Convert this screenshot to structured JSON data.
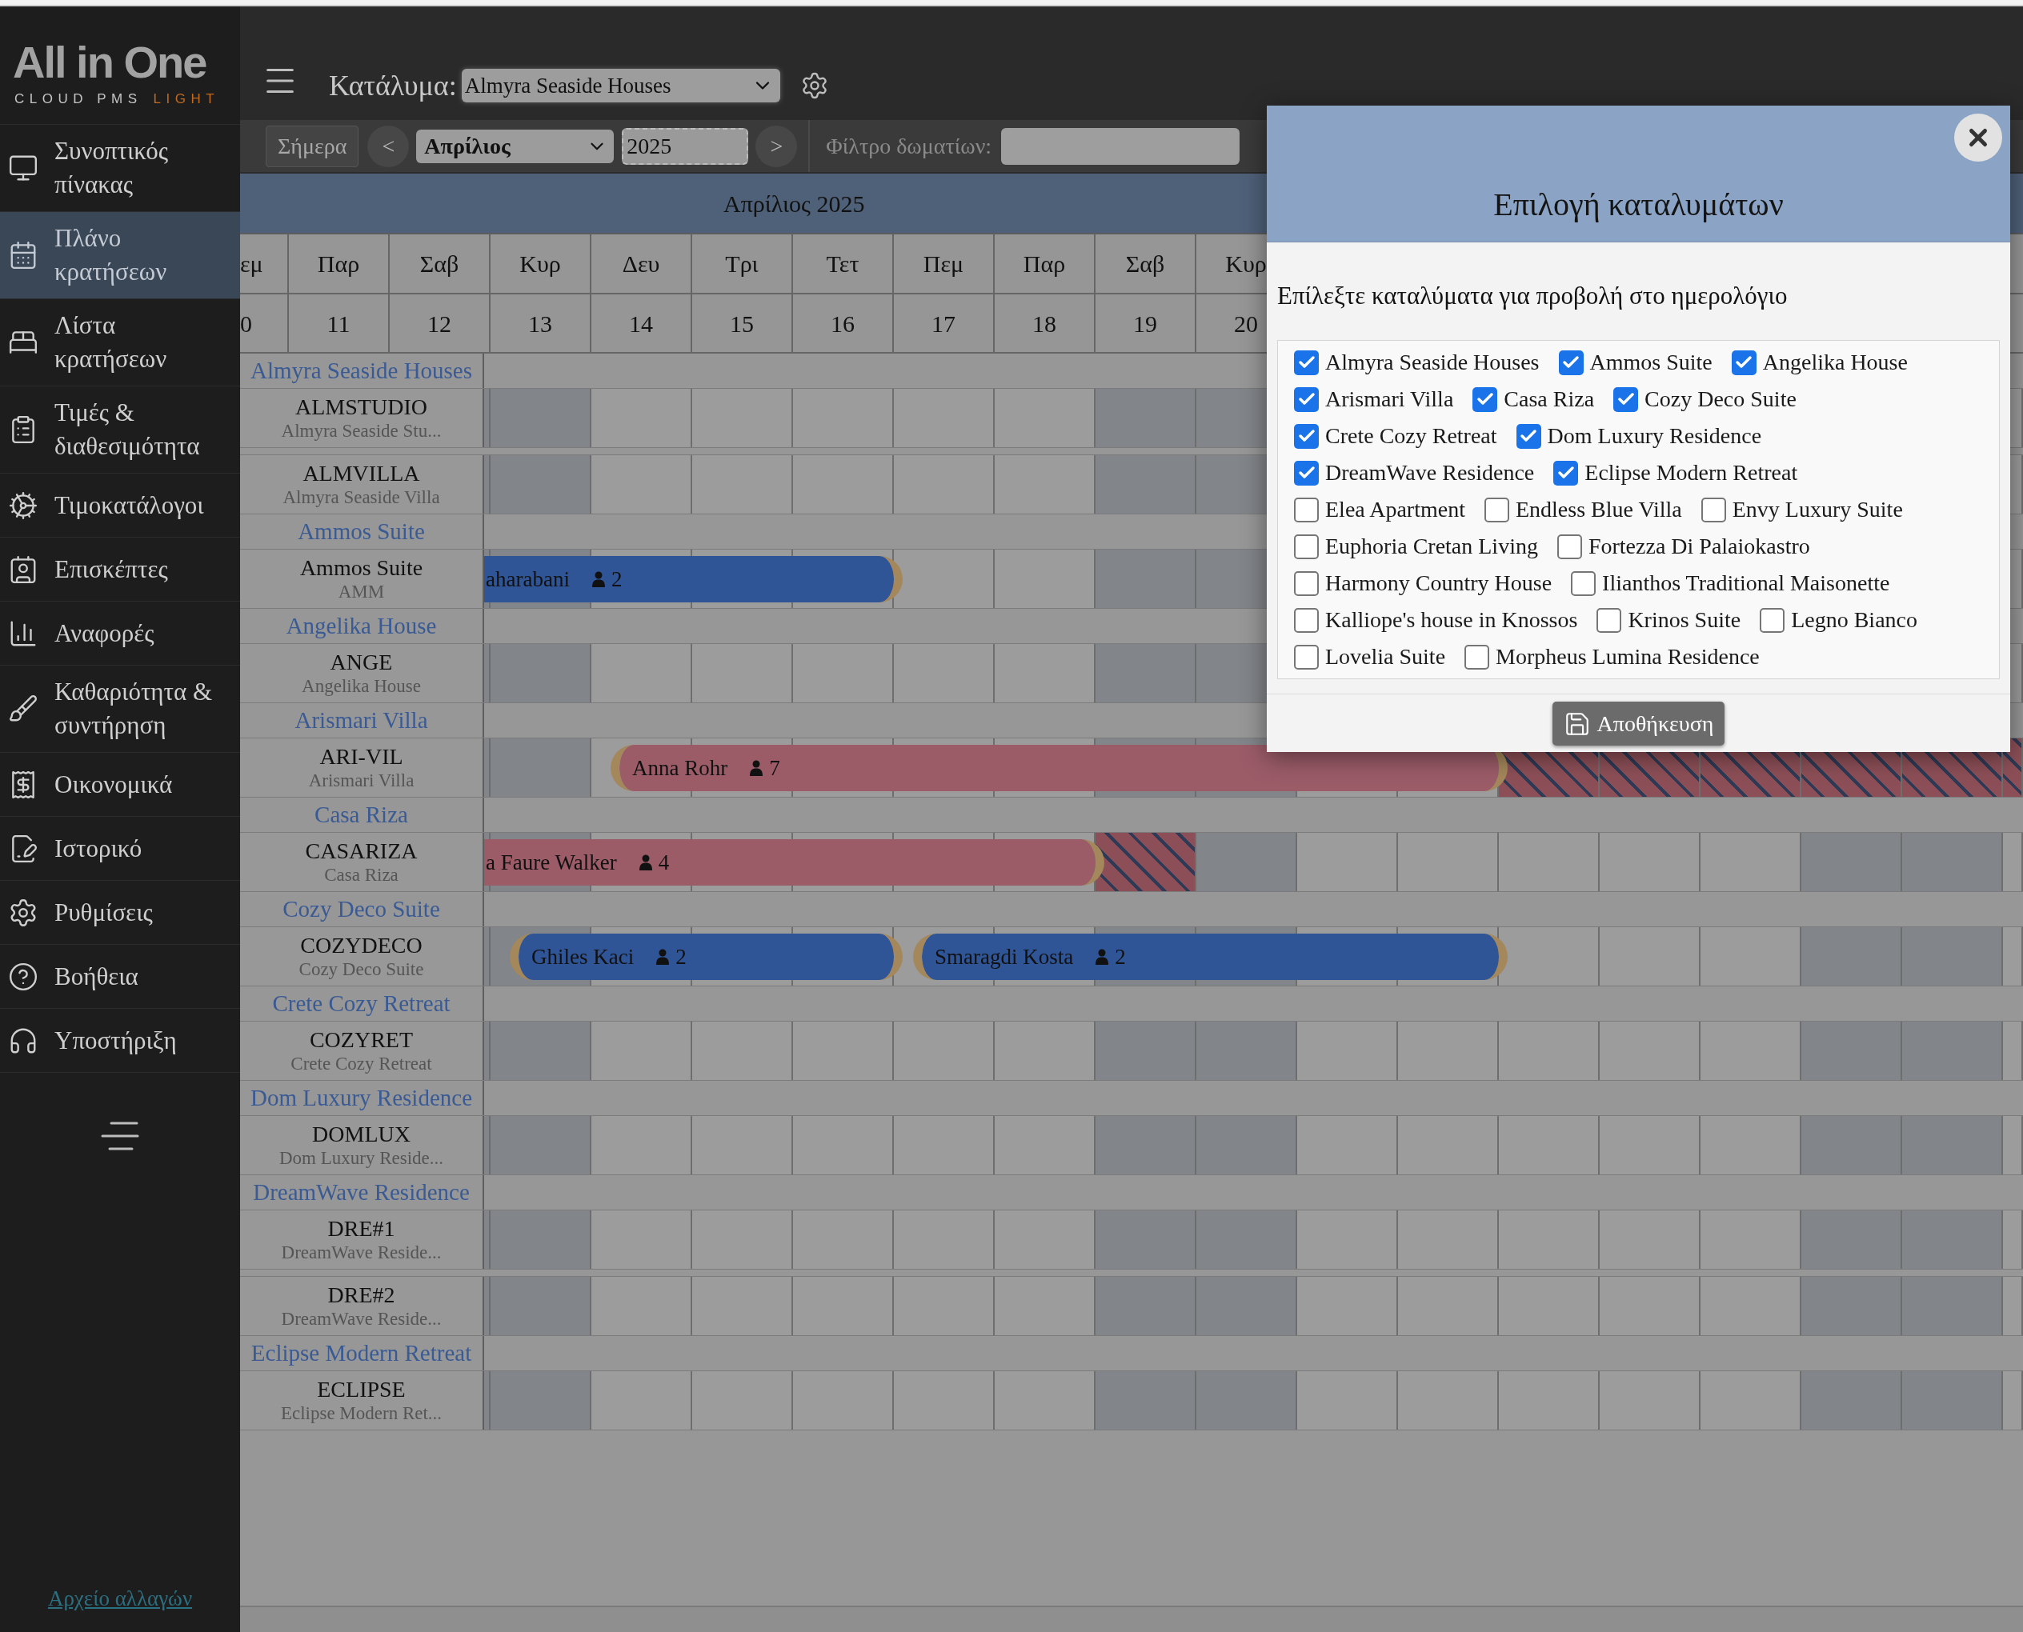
{
  "sidebar": {
    "logo": {
      "title": "All in One",
      "tagline": "CLOUD PMS",
      "edition": "LIGHT"
    },
    "items": [
      {
        "label": "Συνοπτικός πίνακας",
        "selected": false
      },
      {
        "label": "Πλάνο κρατήσεων",
        "selected": true
      },
      {
        "label": "Λίστα κρατήσεων",
        "selected": false
      },
      {
        "label": "Τιμές & διαθεσιμότητα",
        "selected": false
      },
      {
        "label": "Τιμοκατάλογοι",
        "selected": false
      },
      {
        "label": "Επισκέπτες",
        "selected": false
      },
      {
        "label": "Αναφορές",
        "selected": false
      },
      {
        "label": "Καθαριότητα & συντήρηση",
        "selected": false
      },
      {
        "label": "Οικονομικά",
        "selected": false
      },
      {
        "label": "Ιστορικό",
        "selected": false
      },
      {
        "label": "Ρυθμίσεις",
        "selected": false
      },
      {
        "label": "Βοήθεια",
        "selected": false
      },
      {
        "label": "Υποστήριξη",
        "selected": false
      }
    ],
    "changelog_link": "Αρχείο αλλαγών"
  },
  "header": {
    "property_label": "Κατάλυμα:",
    "property_select": "Almyra Seaside Houses"
  },
  "toolbar": {
    "today_button": "Σήμερα",
    "prev_button": "<",
    "month_select": "Απρίλιος",
    "year_field": "2025",
    "next_button": ">",
    "filter_label": "Φίλτρο δωματίων:"
  },
  "calendar": {
    "title": "Απρίλιος 2025",
    "header_days": [
      {
        "day": "εμ",
        "date": "0"
      },
      {
        "day": "Παρ",
        "date": "11"
      },
      {
        "day": "Σαβ",
        "date": "12"
      },
      {
        "day": "Κυρ",
        "date": "13"
      },
      {
        "day": "Δευ",
        "date": "14"
      },
      {
        "day": "Τρι",
        "date": "15"
      },
      {
        "day": "Τετ",
        "date": "16"
      },
      {
        "day": "Πεμ",
        "date": "17"
      },
      {
        "day": "Παρ",
        "date": "18"
      },
      {
        "day": "Σαβ",
        "date": "19"
      },
      {
        "day": "Κυρ",
        "date": "20"
      }
    ],
    "day_columns": [
      {
        "shaded": true
      },
      {
        "shaded": true
      },
      {
        "shaded": false
      },
      {
        "shaded": false
      },
      {
        "shaded": false
      },
      {
        "shaded": false
      },
      {
        "shaded": false
      },
      {
        "shaded": true
      },
      {
        "shaded": true
      },
      {
        "shaded": false
      },
      {
        "shaded": false
      },
      {
        "shaded": false
      },
      {
        "shaded": false
      },
      {
        "shaded": false
      },
      {
        "shaded": true
      },
      {
        "shaded": true
      },
      {
        "shaded": false
      }
    ],
    "groups": [
      {
        "name": "Almyra Seaside Houses",
        "rooms": [
          {
            "title": "ALMSTUDIO",
            "subtitle": "Almyra Seaside Stu..."
          },
          {
            "title": "ALMVILLA",
            "subtitle": "Almyra Seaside Villa"
          }
        ]
      },
      {
        "name": "Ammos Suite",
        "rooms": [
          {
            "title": "Ammos Suite",
            "subtitle": "AMM",
            "bookings": [
              {
                "guest": "aharabani",
                "count": "2",
                "color": "#2f5597"
              }
            ]
          }
        ]
      },
      {
        "name": "Angelika House",
        "rooms": [
          {
            "title": "ANGE",
            "subtitle": "Angelika House"
          }
        ]
      },
      {
        "name": "Arismari Villa",
        "rooms": [
          {
            "title": "ARI-VIL",
            "subtitle": "Arismari Villa",
            "blocked": [
              false,
              false,
              false,
              false,
              false,
              false,
              false,
              false,
              false,
              false,
              false,
              true,
              true,
              true,
              true,
              true,
              true
            ],
            "bookings": [
              {
                "guest": "Anna Rohr",
                "count": "7",
                "color": "#9b5c68"
              }
            ]
          }
        ]
      },
      {
        "name": "Casa Riza",
        "rooms": [
          {
            "title": "CASARIZA",
            "subtitle": "Casa Riza",
            "blocked": [
              false,
              false,
              false,
              false,
              false,
              false,
              false,
              true,
              false,
              false,
              false,
              false,
              false,
              false,
              false,
              false,
              false
            ],
            "bookings": [
              {
                "guest": "a Faure Walker",
                "count": "4",
                "color": "#9b5c68"
              }
            ]
          }
        ]
      },
      {
        "name": "Cozy Deco Suite",
        "rooms": [
          {
            "title": "COZYDECO",
            "subtitle": "Cozy Deco Suite",
            "bookings": [
              {
                "guest": "Ghiles Kaci",
                "count": "2",
                "color": "#2f5597"
              },
              {
                "guest": "Smaragdi Kosta",
                "count": "2",
                "color": "#2f5597"
              }
            ]
          }
        ]
      },
      {
        "name": "Crete Cozy Retreat",
        "rooms": [
          {
            "title": "COZYRET",
            "subtitle": "Crete Cozy Retreat"
          }
        ]
      },
      {
        "name": "Dom Luxury Residence",
        "rooms": [
          {
            "title": "DOMLUX",
            "subtitle": "Dom Luxury Reside..."
          }
        ]
      },
      {
        "name": "DreamWave Residence",
        "rooms": [
          {
            "title": "DRE#1",
            "subtitle": "DreamWave Reside..."
          },
          {
            "title": "DRE#2",
            "subtitle": "DreamWave Reside..."
          }
        ]
      },
      {
        "name": "Eclipse Modern Retreat",
        "rooms": [
          {
            "title": "ECLIPSE",
            "subtitle": "Eclipse Modern Ret..."
          }
        ]
      }
    ]
  },
  "modal": {
    "title": "Επιλογή καταλυμάτων",
    "prompt": "Επίλεξτε καταλύματα για προβολή στο ημερολόγιο",
    "options": [
      {
        "label": "Almyra Seaside Houses",
        "checked": true
      },
      {
        "label": "Ammos Suite",
        "checked": true
      },
      {
        "label": "Angelika House",
        "checked": true
      },
      {
        "label": "Arismari Villa",
        "checked": true
      },
      {
        "label": "Casa Riza",
        "checked": true
      },
      {
        "label": "Cozy Deco Suite",
        "checked": true
      },
      {
        "label": "Crete Cozy Retreat",
        "checked": true
      },
      {
        "label": "Dom Luxury Residence",
        "checked": true
      },
      {
        "label": "DreamWave Residence",
        "checked": true
      },
      {
        "label": "Eclipse Modern Retreat",
        "checked": true
      },
      {
        "label": "Elea Apartment",
        "checked": false
      },
      {
        "label": "Endless Blue Villa",
        "checked": false
      },
      {
        "label": "Envy Luxury Suite",
        "checked": false
      },
      {
        "label": "Euphoria Cretan Living",
        "checked": false
      },
      {
        "label": "Fortezza Di Palaiokastro",
        "checked": false
      },
      {
        "label": "Harmony Country House",
        "checked": false
      },
      {
        "label": "Ilianthos Traditional Maisonette",
        "checked": false
      },
      {
        "label": "Kalliope's house in Knossos",
        "checked": false
      },
      {
        "label": "Krinos Suite",
        "checked": false
      },
      {
        "label": "Legno Bianco",
        "checked": false
      },
      {
        "label": "Lovelia Suite",
        "checked": false
      },
      {
        "label": "Morpheus Lumina Residence",
        "checked": false
      }
    ],
    "save_button": "Αποθήκευση"
  }
}
